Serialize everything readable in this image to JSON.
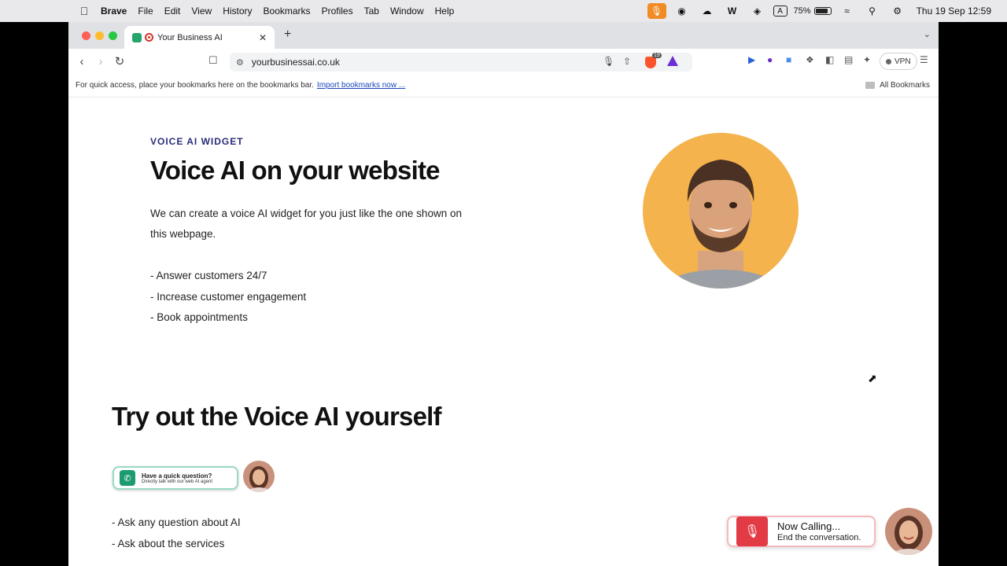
{
  "menubar": {
    "items": [
      "Brave",
      "File",
      "Edit",
      "View",
      "History",
      "Bookmarks",
      "Profiles",
      "Tab",
      "Window",
      "Help"
    ],
    "battery": "75%",
    "clock": "Thu 19 Sep  12:59"
  },
  "browser": {
    "tab_title": "Your Business AI",
    "url": "yourbusinessai.co.uk",
    "shield_badge": "19",
    "vpn_label": "VPN",
    "bookmarks_message": "For quick access, place your bookmarks here on the bookmarks bar.",
    "import_link": "Import bookmarks now ...",
    "all_bookmarks": "All Bookmarks"
  },
  "page": {
    "eyebrow": "VOICE AI WIDGET",
    "title": "Voice AI on your website",
    "paragraph": "We can create a voice AI widget for you just like the one shown on this webpage.",
    "bullets": [
      "- Answer customers 24/7",
      "- Increase customer engagement",
      "- Book appointments"
    ],
    "section_title": "Try out the Voice AI yourself",
    "widget": {
      "line1": "Have a quick question?",
      "line2": "Directly talk with our web AI agent"
    },
    "bullets2": [
      "- Ask any question about AI",
      "- Ask about the services"
    ]
  },
  "call_widget": {
    "title": "Now Calling...",
    "subtitle": "End the conversation."
  },
  "colors": {
    "accent_orange": "#f4b34d",
    "call_red": "#e23b45",
    "eyebrow_navy": "#2a2c7a",
    "whatsapp_green": "#1c9b6f"
  }
}
